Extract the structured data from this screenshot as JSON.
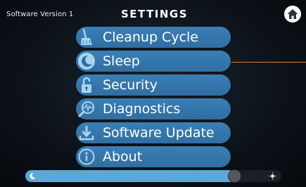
{
  "header": {
    "version_text": "Software Version 1",
    "title": "SETTINGS",
    "home_icon": "home-icon"
  },
  "menu": {
    "items": [
      {
        "label": "Cleanup Cycle",
        "icon": "broom-icon"
      },
      {
        "label": "Sleep",
        "icon": "moon-icon"
      },
      {
        "label": "Security",
        "icon": "padlock-icon"
      },
      {
        "label": "Diagnostics",
        "icon": "heartbeat-icon"
      },
      {
        "label": "Software Update",
        "icon": "download-icon"
      },
      {
        "label": "About",
        "icon": "info-icon"
      }
    ]
  },
  "brightness": {
    "value": 0.82,
    "left_icon": "moon-icon",
    "right_icon": "sun-icon"
  },
  "colors": {
    "button": "#3a7fb5",
    "slider_fill": "#5aa9d6",
    "leader_line": "#d9822b"
  }
}
